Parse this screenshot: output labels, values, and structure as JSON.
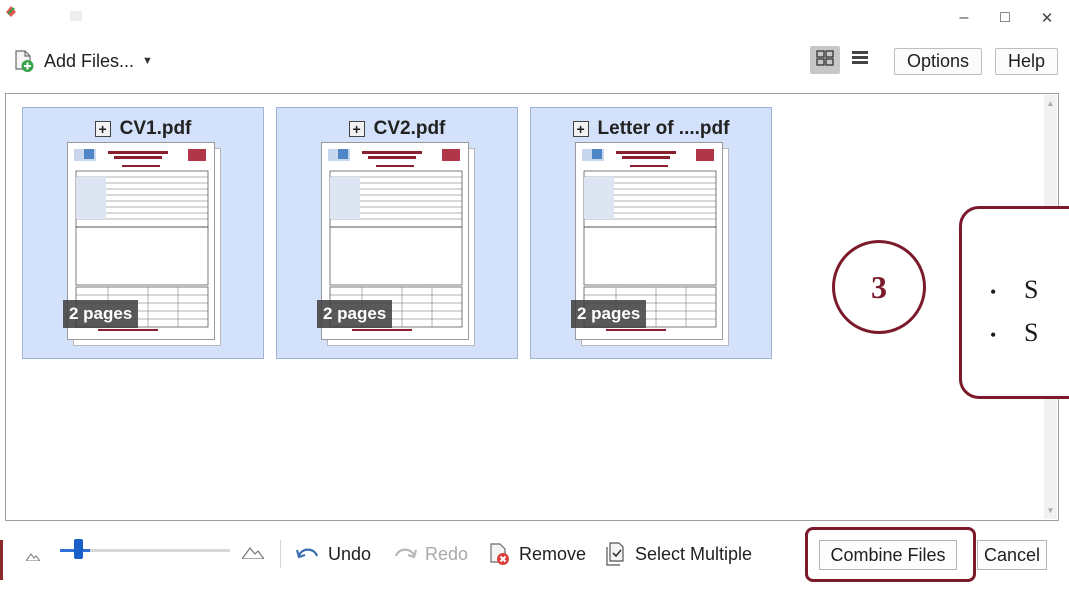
{
  "window": {
    "minimize_glyph": "–",
    "maximize_glyph": "□",
    "close_glyph": "✕"
  },
  "toolbar": {
    "add_files_label": "Add Files...",
    "add_files_caret": "▼",
    "options_label": "Options",
    "help_label": "Help",
    "view_modes": [
      "grid-view-icon",
      "list-view-icon"
    ],
    "selected_view": "grid"
  },
  "files": [
    {
      "name": "CV1.pdf",
      "pages_label": "2 pages",
      "expand_glyph": "+"
    },
    {
      "name": "CV2.pdf",
      "pages_label": "2 pages",
      "expand_glyph": "+"
    },
    {
      "name": "Letter of ....pdf",
      "pages_label": "2 pages",
      "expand_glyph": "+"
    }
  ],
  "callout": {
    "step_number": "3",
    "bullets": [
      "S",
      "S"
    ],
    "bullet_glyph": "•",
    "accent_color": "#7b1a2b"
  },
  "bottom_bar": {
    "zoom_level": 0.1,
    "undo_label": "Undo",
    "redo_label": "Redo",
    "redo_enabled": false,
    "remove_label": "Remove",
    "select_multiple_label": "Select Multiple",
    "combine_label": "Combine Files",
    "cancel_label": "Cancel"
  },
  "colors": {
    "card_bg": "#d3e1fa",
    "selected_view_bg": "#c7c7c7",
    "slider_accent": "#1a5fc7"
  }
}
